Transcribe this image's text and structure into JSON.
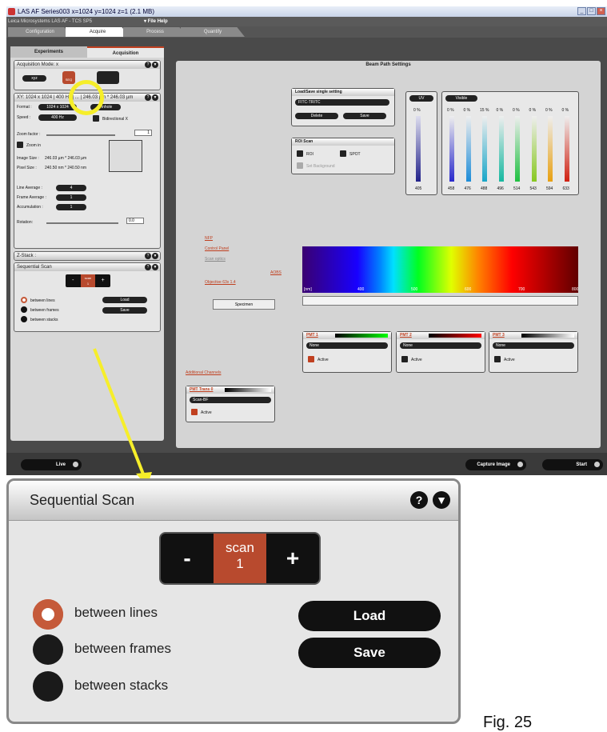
{
  "window": {
    "title": "LAS AF   Series003 x=1024 y=1024 z=1  (2.1 MB)",
    "app_label": "Leica Microsystems LAS AF  -  TCS SP5",
    "menu": [
      "File",
      "Help"
    ]
  },
  "main_tabs": [
    "Configuration",
    "Acquire",
    "Process",
    "Quantify"
  ],
  "active_main_tab": "Acquire",
  "left_tabs": [
    "Experiments",
    "Acquisition"
  ],
  "acquisition_mode": {
    "header": "Acquisition Mode: x",
    "mode_a": "xyz",
    "mode_b": "SEQ"
  },
  "xy_panel": {
    "header": "XY: 1024 x 1024 | 400 Hz | ... | 246.03 µm * 246.03 µm",
    "format_label": "Format :",
    "format_value": "1024 x 1024",
    "pinhole": "Pinhole",
    "speed_label": "Speed :",
    "speed_value": "400 Hz",
    "bidirectional": "Bidirectional X",
    "zoom_factor_label": "Zoom factor :",
    "zoom_factor_value": "1",
    "zoom_in": "Zoom in",
    "image_size_label": "Image Size :",
    "image_size_value": "246.03 µm * 246.03 µm",
    "pixel_size_label": "Pixel Size :",
    "pixel_size_value": "240.50 nm * 240.50 nm",
    "line_average_label": "Line Average :",
    "line_average_value": "4",
    "frame_average_label": "Frame Average :",
    "frame_average_value": "1",
    "accumulation_label": "Accumulation :",
    "accumulation_value": "1",
    "rotation_label": "Rotation:",
    "rotation_value": "0.0"
  },
  "zstack_header": "Z-Stack :",
  "sequential_small": {
    "header": "Sequential Scan",
    "scan_label": "scan",
    "scan_number": "1",
    "between_lines": "between lines",
    "between_frames": "between frames",
    "between_stacks": "between stacks",
    "load": "Load",
    "save": "Save"
  },
  "beam": {
    "title": "Beam Path Settings",
    "load_save_header": "Load/Save single setting",
    "setting_value": "FITC-TRITC",
    "delete": "Delete",
    "save": "Save",
    "roi_header": "ROI Scan",
    "roi": "ROI",
    "spot": "SPOT",
    "set_background": "Set Background",
    "uv": "UV",
    "uv_percent": "0 %",
    "uv_line": "405",
    "visible": "Visible",
    "visible_percents": [
      "0 %",
      "0 %",
      "15 %",
      "0 %",
      "0 %",
      "0 %",
      "0 %",
      "0 %"
    ],
    "visible_lines": [
      "458",
      "476",
      "488",
      "496",
      "514",
      "543",
      "594",
      "633"
    ],
    "lines_colors": [
      "#2a2acc",
      "#1c8cd8",
      "#18a6c8",
      "#16b8a0",
      "#1ec040",
      "#88c820",
      "#e8a010",
      "#d02010"
    ],
    "links": [
      "NFP",
      "Control Panel",
      "Scan optics",
      "Objective 63x 1.4"
    ],
    "aobs": "AOBS",
    "specimen": "Specimen",
    "spectrum_ticks": [
      "[nm]",
      "400",
      "500",
      "600",
      "700",
      "800"
    ],
    "pmt1": "PMT 1",
    "pmt2": "PMT 2",
    "pmt3": "PMT 3",
    "pmt_value": "None",
    "active": "Active",
    "additional_channels": "Additional Channels",
    "pmt_trans": "PMT Trans 0",
    "scan_bf": "Scan-BF"
  },
  "bottom": {
    "live": "Live",
    "capture": "Capture Image",
    "start": "Start"
  },
  "zoom": {
    "title": "Sequential Scan",
    "help_icon": "?",
    "collapse_icon": "▼",
    "minus": "-",
    "plus": "+",
    "scan_label": "scan",
    "scan_number": "1",
    "between_lines": "between lines",
    "between_frames": "between frames",
    "between_stacks": "between stacks",
    "load": "Load",
    "save": "Save"
  },
  "figure_label": "Fig. 25",
  "colors": {
    "accent": "#c04020",
    "highlight": "#f6ee2a",
    "scan_bg": "#b84a2e"
  }
}
